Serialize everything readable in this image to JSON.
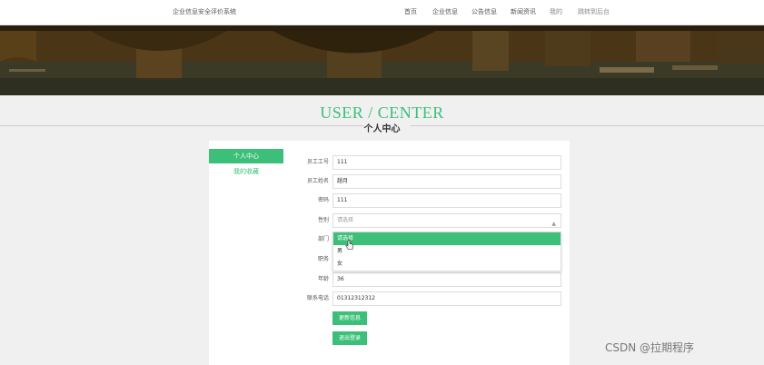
{
  "site": {
    "title": "企业信息安全评价系统"
  },
  "nav": {
    "items": [
      "首页",
      "企业信息",
      "公告信息",
      "新闻资讯",
      "我的",
      "跳转到后台"
    ]
  },
  "hero": {
    "title": "USER / CENTER",
    "subtitle": "个人中心"
  },
  "side_menu": {
    "items": [
      "个人中心",
      "我的收藏"
    ]
  },
  "form": {
    "fields": [
      {
        "label": "员工工号",
        "value": "111"
      },
      {
        "label": "员工姓名",
        "value": "趙月"
      },
      {
        "label": "密码",
        "value": "111"
      },
      {
        "label": "性别",
        "value": "请选择"
      },
      {
        "label": "部门",
        "value": ""
      },
      {
        "label": "职务",
        "value": ""
      },
      {
        "label": "年龄",
        "value": "36"
      },
      {
        "label": "联系电话",
        "value": "01312312312"
      }
    ],
    "gender_options": [
      "请选择",
      "男",
      "女"
    ],
    "buttons": {
      "update": "更新信息",
      "logout": "退出登录"
    }
  },
  "watermark": "CSDN @拉期程序",
  "colors": {
    "accent": "#3cbf79"
  }
}
